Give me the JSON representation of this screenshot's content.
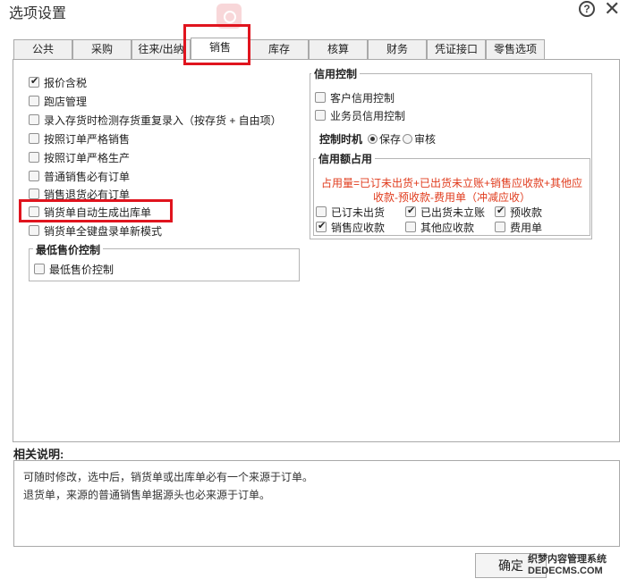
{
  "window": {
    "title": "选项设置",
    "help_glyph": "?",
    "close_glyph": "✕"
  },
  "tabs": [
    {
      "label": "公共"
    },
    {
      "label": "采购"
    },
    {
      "label": "往来/出纳"
    },
    {
      "label": "销售",
      "active": true
    },
    {
      "label": "库存"
    },
    {
      "label": "核算"
    },
    {
      "label": "财务"
    },
    {
      "label": "凭证接口"
    },
    {
      "label": "零售选项"
    }
  ],
  "left_options": [
    {
      "label": "报价含税",
      "checked": true
    },
    {
      "label": "跑店管理",
      "checked": false
    },
    {
      "label": "录入存货时检测存货重复录入（按存货 + 自由项）",
      "checked": false
    },
    {
      "label": "按照订单严格销售",
      "checked": false
    },
    {
      "label": "按照订单严格生产",
      "checked": false
    },
    {
      "label": "普通销售必有订单",
      "checked": false
    },
    {
      "label": "销售退货必有订单",
      "checked": false
    },
    {
      "label": "销货单自动生成出库单",
      "checked": false
    },
    {
      "label": "销货单全键盘录单新模式",
      "checked": false
    }
  ],
  "min_price_group": {
    "title": "最低售价控制",
    "option": {
      "label": "最低售价控制",
      "checked": false
    }
  },
  "credit_group": {
    "title": "信用控制",
    "options": [
      {
        "label": "客户信用控制",
        "checked": false
      },
      {
        "label": "业务员信用控制",
        "checked": false
      }
    ],
    "timing_label": "控制时机",
    "timing_options": [
      {
        "label": "保存",
        "selected": true
      },
      {
        "label": "审核",
        "selected": false
      }
    ]
  },
  "credit_usage_group": {
    "title": "信用额占用",
    "formula_line1": "占用量=已订未出货+已出货未立账+销售应收款+其他应",
    "formula_line2": "收款-预收款-费用单（冲减应收）",
    "options": [
      {
        "label": "已订未出货",
        "checked": false
      },
      {
        "label": "已出货未立账",
        "checked": true
      },
      {
        "label": "预收款",
        "checked": true
      },
      {
        "label": "销售应收款",
        "checked": true
      },
      {
        "label": "其他应收款",
        "checked": false
      },
      {
        "label": "费用单",
        "checked": false
      }
    ]
  },
  "description": {
    "label": "相关说明:",
    "lines": [
      "可随时修改，选中后，销货单或出库单必有一个来源于订单。",
      "退货单，来源的普通销售单据源头也必来源于订单。"
    ]
  },
  "footer": {
    "ok_label": "确定",
    "watermark_line1": "织梦内容管理系统",
    "watermark_line2": "DEDECMS.COM"
  },
  "colors": {
    "highlight": "#e0141e",
    "formula_text": "#e03c1e"
  }
}
